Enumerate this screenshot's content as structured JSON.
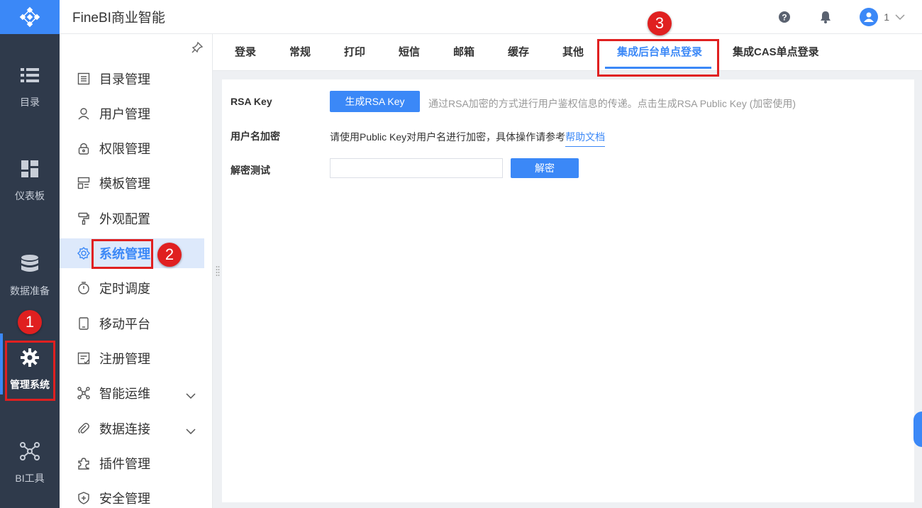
{
  "app": {
    "title": "FineBI商业智能"
  },
  "rail": {
    "items": [
      {
        "label": "目录",
        "icon": "list-icon"
      },
      {
        "label": "仪表板",
        "icon": "dashboard-icon"
      },
      {
        "label": "数据准备",
        "icon": "database-icon"
      },
      {
        "label": "管理系统",
        "icon": "gear-icon",
        "active": true
      },
      {
        "label": "BI工具",
        "icon": "network-icon"
      }
    ]
  },
  "header": {
    "user_name": "1"
  },
  "menu": {
    "items": [
      {
        "label": "目录管理",
        "icon": "catalog-icon"
      },
      {
        "label": "用户管理",
        "icon": "user-icon"
      },
      {
        "label": "权限管理",
        "icon": "lock-icon"
      },
      {
        "label": "模板管理",
        "icon": "template-icon"
      },
      {
        "label": "外观配置",
        "icon": "paint-roller-icon"
      },
      {
        "label": "系统管理",
        "icon": "settings-icon",
        "active": true
      },
      {
        "label": "定时调度",
        "icon": "timer-icon"
      },
      {
        "label": "移动平台",
        "icon": "tablet-icon"
      },
      {
        "label": "注册管理",
        "icon": "register-icon"
      },
      {
        "label": "智能运维",
        "icon": "ops-icon",
        "expandable": true
      },
      {
        "label": "数据连接",
        "icon": "paperclip-icon",
        "expandable": true
      },
      {
        "label": "插件管理",
        "icon": "puzzle-icon"
      },
      {
        "label": "安全管理",
        "icon": "shield-icon"
      }
    ]
  },
  "tabs": [
    {
      "label": "登录"
    },
    {
      "label": "常规"
    },
    {
      "label": "打印"
    },
    {
      "label": "短信"
    },
    {
      "label": "邮箱"
    },
    {
      "label": "缓存"
    },
    {
      "label": "其他"
    },
    {
      "label": "集成后台单点登录",
      "active": true
    },
    {
      "label": "集成CAS单点登录"
    }
  ],
  "content": {
    "rsa_key": {
      "label": "RSA Key",
      "button": "生成RSA Key",
      "hint": "通过RSA加密的方式进行用户鉴权信息的传递。点击生成RSA Public Key (加密使用)"
    },
    "username_encrypt": {
      "label": "用户名加密",
      "desc": "请使用Public Key对用户名进行加密，具体操作请参考",
      "link": "帮助文档"
    },
    "decrypt_test": {
      "label": "解密测试",
      "input_value": "",
      "button": "解密"
    }
  },
  "annotations": {
    "badge1": "1",
    "badge2": "2",
    "badge3": "3"
  },
  "colors": {
    "accent": "#3b88f7",
    "rail_bg": "#2f3a4b",
    "annotation": "#e02020"
  }
}
